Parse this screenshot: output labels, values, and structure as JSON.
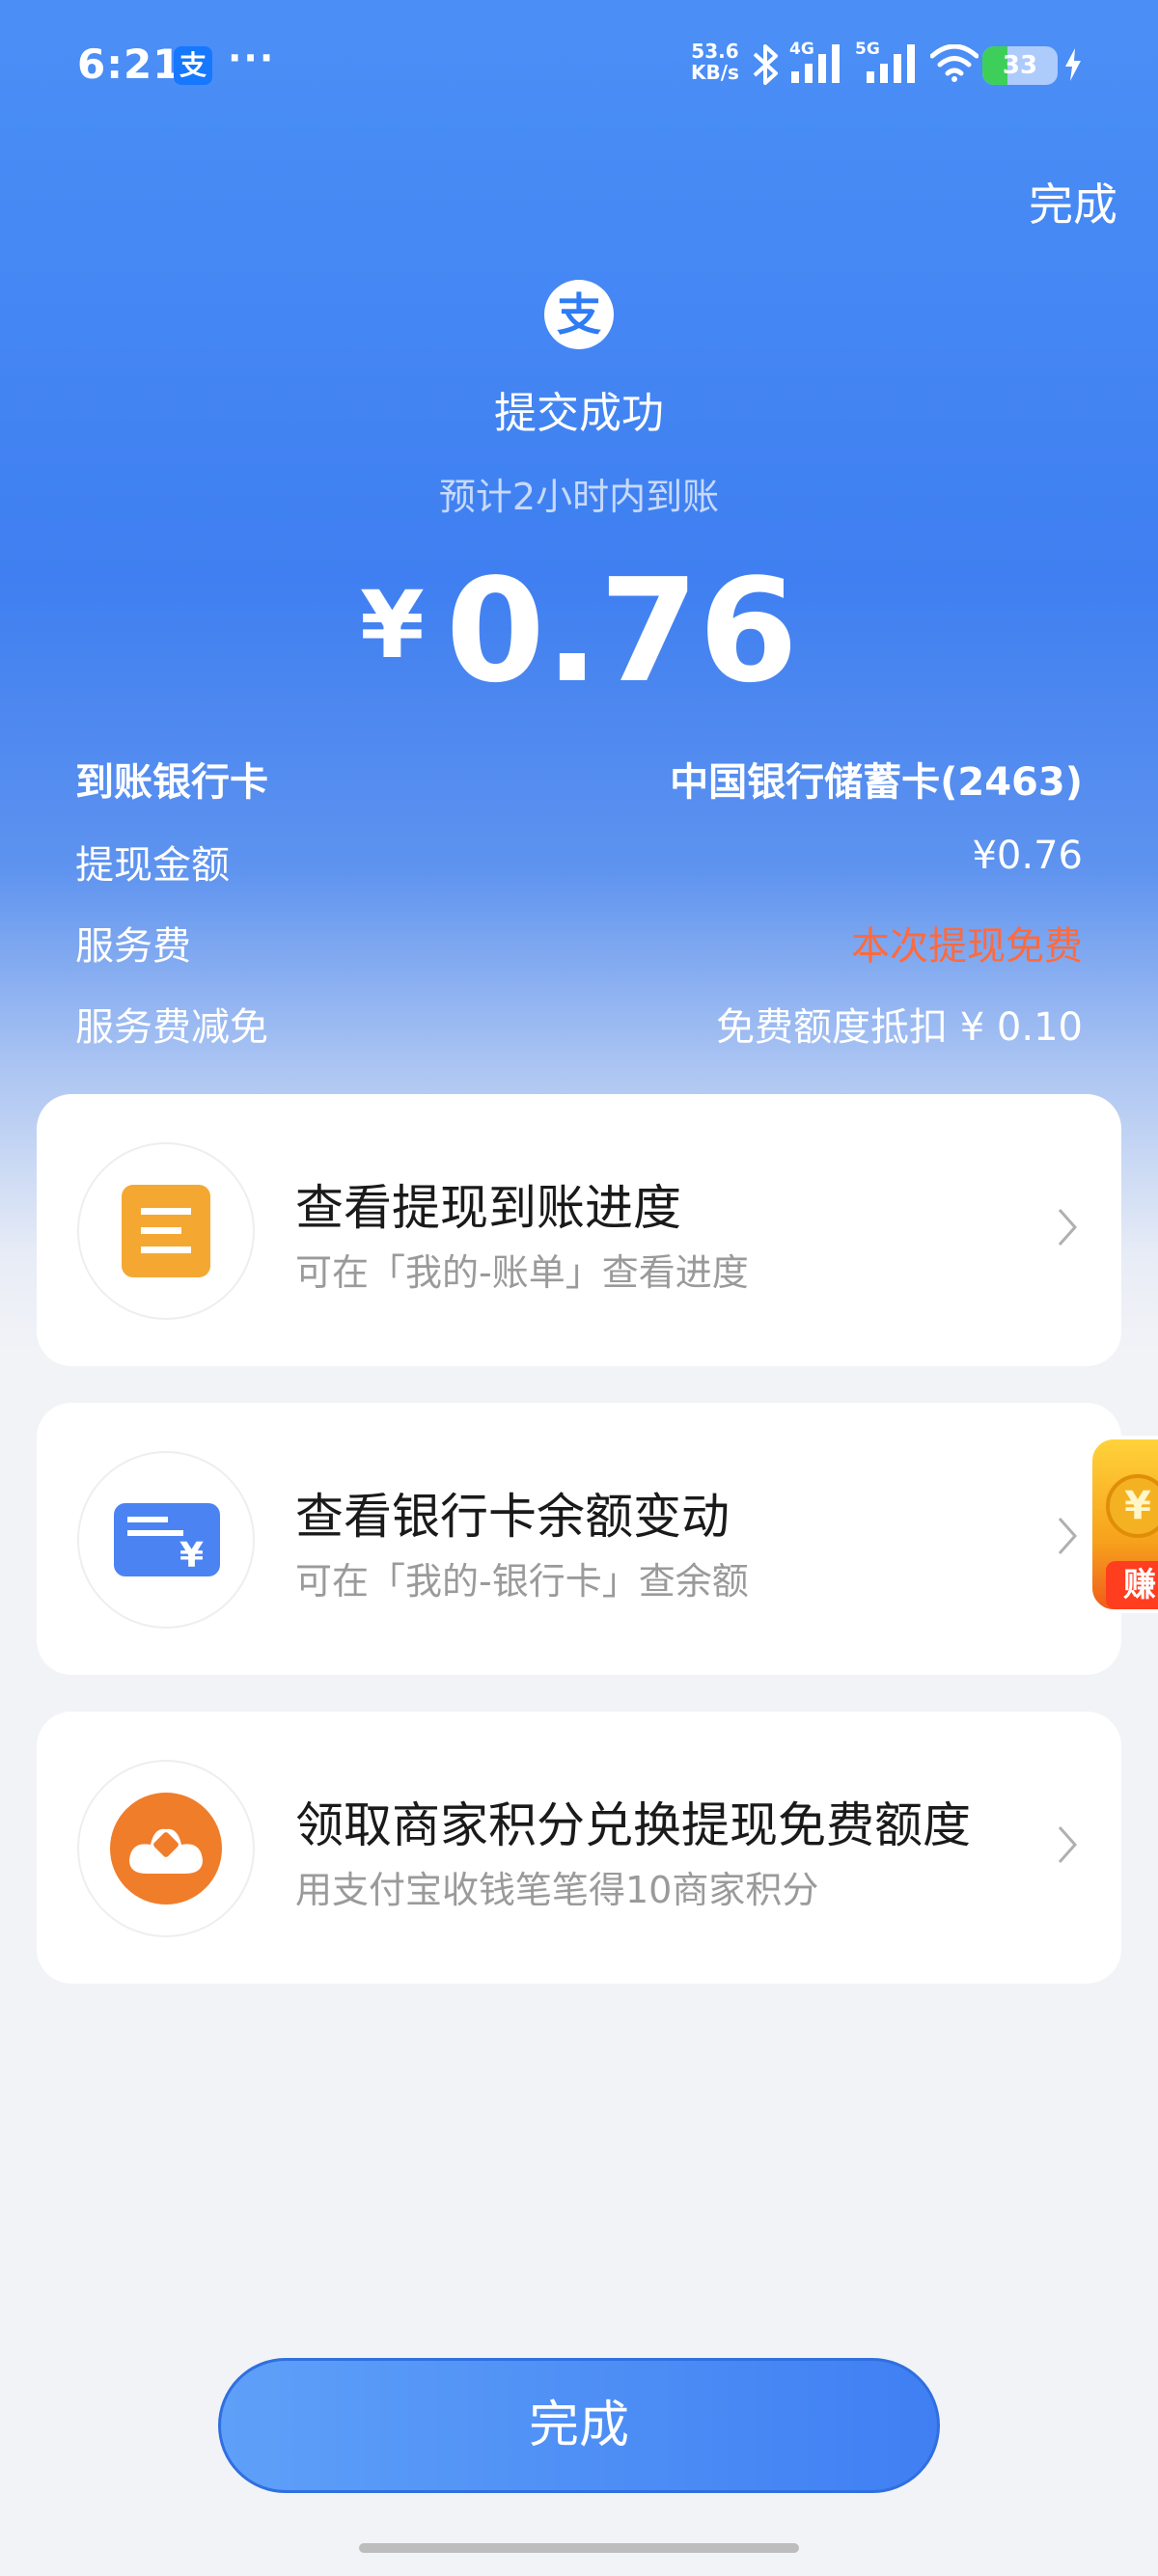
{
  "status_bar": {
    "time": "6:21",
    "app_icon_glyph": "支",
    "more": "···",
    "net_speed_value": "53.6",
    "net_speed_unit": "KB/s",
    "signal1_label": "4G",
    "signal2_label": "5G",
    "battery_level": 33,
    "battery_text": "33"
  },
  "header": {
    "done_label": "完成",
    "logo_glyph": "支",
    "title": "提交成功",
    "subtitle": "预计2小时内到账",
    "currency": "¥",
    "amount": "0.76"
  },
  "details": [
    {
      "label": "到账银行卡",
      "value": "中国银行储蓄卡(2463)"
    },
    {
      "label": "提现金额",
      "value": "¥0.76"
    },
    {
      "label": "服务费",
      "value": "本次提现免费"
    },
    {
      "label": "服务费减免",
      "value": "免费额度抵扣 ¥ 0.10"
    }
  ],
  "cards": [
    {
      "title": "查看提现到账进度",
      "desc": "可在「我的-账单」查看进度",
      "icon": "bill-list-icon"
    },
    {
      "title": "查看银行卡余额变动",
      "desc": "可在「我的-银行卡」查余额",
      "icon": "bank-card-icon"
    },
    {
      "title": "领取商家积分兑换提现免费额度",
      "desc": "用支付宝收钱笔笔得10商家积分",
      "icon": "merchant-points-icon"
    }
  ],
  "float_widget": {
    "coin_glyph": "¥",
    "tag": "赚"
  },
  "footer": {
    "done_button": "完成"
  },
  "colors": {
    "brand_blue": "#3f7ff1",
    "warning_orange": "#ff6a3d",
    "bill_icon": "#f4a832",
    "card_icon": "#4b84f2",
    "points_icon": "#f07d2a"
  }
}
